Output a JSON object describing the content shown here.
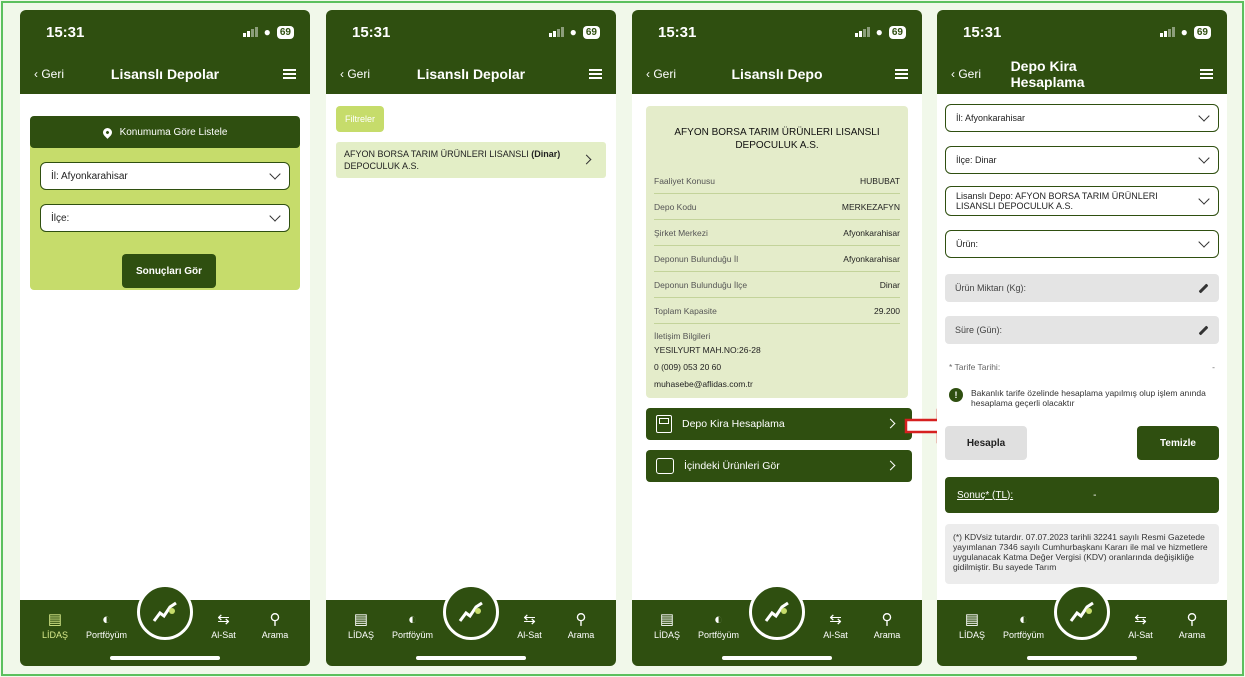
{
  "status": {
    "time": "15:31",
    "battery": "69"
  },
  "tabbar": {
    "tabs": [
      {
        "label": "LİDAŞ",
        "icon": "bar-chart-icon"
      },
      {
        "label": "Portföyüm",
        "icon": "pie-chart-icon"
      },
      {
        "label": "Al-Sat",
        "icon": "swap-arrows-icon"
      },
      {
        "label": "Arama",
        "icon": "search-icon"
      }
    ]
  },
  "phone1": {
    "back": "Geri",
    "title": "Lisanslı Depolar",
    "geo_button": "Konumuma Göre Listele",
    "il_select": "İl: Afyonkarahisar",
    "ilce_select": "İlçe:",
    "results_button": "Sonuçları Gör"
  },
  "phone2": {
    "back": "Geri",
    "title": "Lisanslı Depolar",
    "filter_chip": "Filtreler",
    "result_name": "AFYON BORSA TARIM ÜRÜNLERI LISANSLI",
    "result_name2": "DEPOCULUK A.S.",
    "result_district": "(Dinar)"
  },
  "phone3": {
    "back": "Geri",
    "title": "Lisanslı Depo",
    "company": "AFYON BORSA TARIM ÜRÜNLERI LISANSLI DEPOCULUK A.S.",
    "details": [
      {
        "label": "Faaliyet Konusu",
        "value": "HUBUBAT"
      },
      {
        "label": "Depo Kodu",
        "value": "MERKEZAFYN"
      },
      {
        "label": "Şirket Merkezi",
        "value": "Afyonkarahisar"
      },
      {
        "label": "Deponun Bulunduğu İl",
        "value": "Afyonkarahisar"
      },
      {
        "label": "Deponun Bulunduğu İlçe",
        "value": "Dinar"
      },
      {
        "label": "Toplam Kapasite",
        "value": "29.200"
      }
    ],
    "contact_label": "İletişim Bilgileri",
    "address": "YESILYURT MAH.NO:26-28",
    "phone": "0 (009) 053 20 60",
    "email": "muhasebe@aflidas.com.tr",
    "action_rent": "Depo Kira Hesaplama",
    "action_products": "İçindeki Ürünleri Gör"
  },
  "phone4": {
    "back": "Geri",
    "title": "Depo Kira Hesaplama",
    "il_select": "İl: Afyonkarahisar",
    "ilce_select": "İlçe: Dinar",
    "depo_select_1": "Lisanslı Depo: AFYON BORSA TARIM ÜRÜNLERI",
    "depo_select_2": "LISANSLI DEPOCULUK A.S.",
    "urun_select": "Ürün:",
    "miktar_placeholder": "Ürün Miktarı (Kg):",
    "sure_placeholder": "Süre (Gün):",
    "tarife_label": "* Tarife Tarihi:",
    "tarife_value": "-",
    "info_text": "Bakanlık tarife özelinde hesaplama yapılmış olup işlem anında hesaplama geçerli olacaktır",
    "calc_button": "Hesapla",
    "clear_button": "Temizle",
    "result_label": "Sonuç* (TL):",
    "result_value": "-",
    "note": "(*) KDVsiz tutardır. 07.07.2023 tarihli 32241 sayılı Resmi Gazetede yayımlanan 7346 sayılı Cumhurbaşkanı Kararı ile mal ve hizmetlere uygulanacak Katma Değer Vergisi (KDV) oranlarında değişikliğe gidilmiştir. Bu sayede Tarım"
  },
  "colors": {
    "primary": "#2f4f10",
    "accent": "#c6dc6b",
    "border": "#5cc05e",
    "arrow": "#d62020"
  }
}
